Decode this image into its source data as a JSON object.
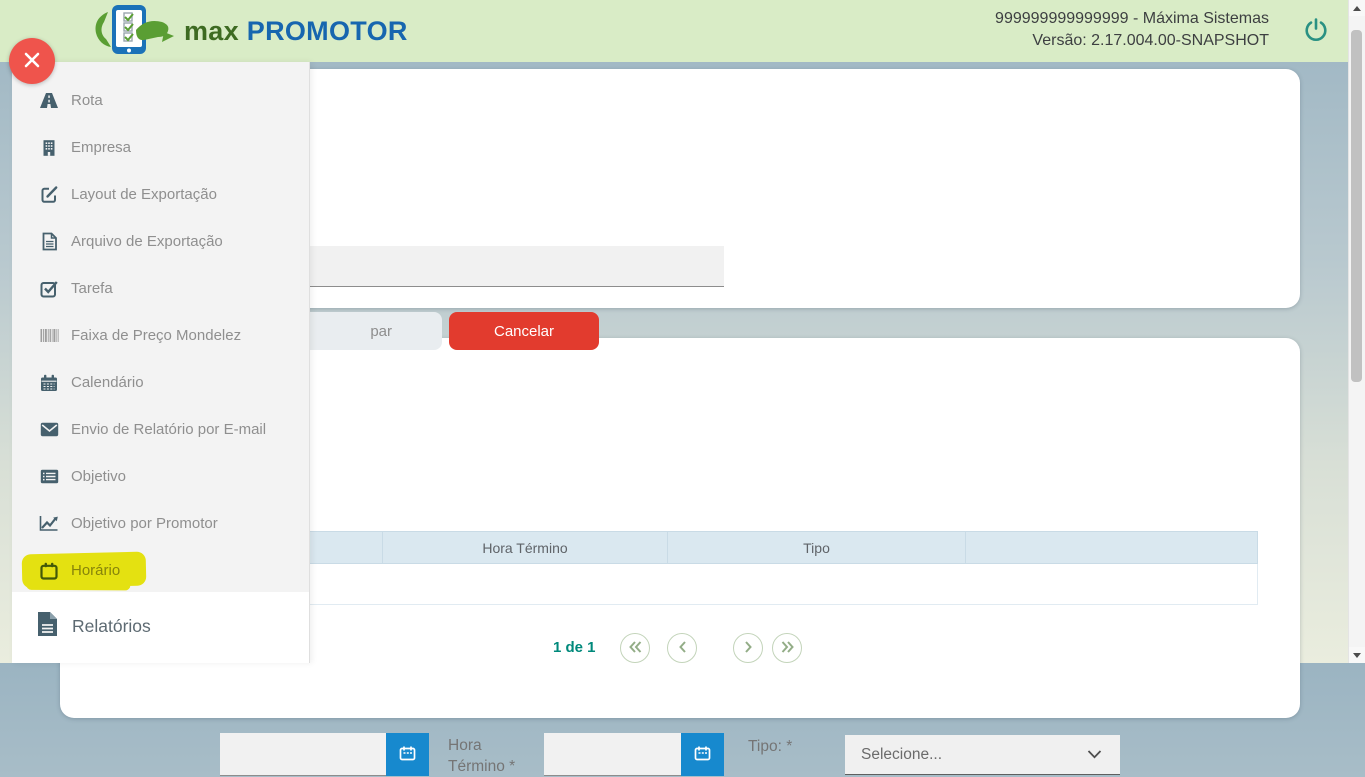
{
  "header": {
    "brand_max": "max",
    "brand_promotor": "PROMOTOR",
    "account": "999999999999999 - Máxima Sistemas",
    "version": "Versão: 2.17.004.00-SNAPSHOT",
    "power_icon": "power-icon"
  },
  "sidebar": {
    "close_icon": "close-icon",
    "items": [
      {
        "label": "Rota",
        "icon": "road-icon"
      },
      {
        "label": "Empresa",
        "icon": "building-icon"
      },
      {
        "label": "Layout de Exportação",
        "icon": "edit-icon"
      },
      {
        "label": "Arquivo de Exportação",
        "icon": "file-icon"
      },
      {
        "label": "Tarefa",
        "icon": "task-check-icon"
      },
      {
        "label": "Faixa de Preço Mondelez",
        "icon": "barcode-icon"
      },
      {
        "label": "Calendário",
        "icon": "calendar-icon"
      },
      {
        "label": "Envio de Relatório por E-mail",
        "icon": "envelope-icon"
      },
      {
        "label": "Objetivo",
        "icon": "list-icon"
      },
      {
        "label": "Objetivo por Promotor",
        "icon": "line-chart-icon"
      },
      {
        "label": "Horário",
        "icon": "schedule-icon",
        "highlighted": true
      }
    ],
    "report_item": {
      "label": "Relatórios",
      "icon": "report-icon"
    }
  },
  "form_card": {
    "search_input_value": "",
    "clear_button_visible": "par",
    "cancel_button": "Cancelar"
  },
  "schedule_card": {
    "hora_inicio_value": "",
    "hora_termino_label": "Hora Término *",
    "hora_termino_value": "",
    "tipo_label": "Tipo: *",
    "tipo_select_value": "Selecione...",
    "calendar_button_icon": "calendar-picker-icon",
    "table_headers": [
      "",
      "Hora Término",
      "Tipo",
      ""
    ],
    "table_rows": [
      [
        "",
        "",
        "",
        ""
      ]
    ],
    "pagination": {
      "page_label": "1 de 1",
      "buttons": [
        "first-page-icon",
        "prev-page-icon",
        "next-page-icon",
        "last-page-icon"
      ]
    }
  },
  "colors": {
    "header_bg": "#d9ecc6",
    "brand_green": "#3e6b22",
    "brand_blue": "#1766af",
    "accent_blue": "#1789ce",
    "cancel_red": "#e23b2e",
    "close_red": "#ef544c",
    "pagination_teal": "#00897b",
    "highlight_yellow": "#f0ec11",
    "table_header_bg": "#dae8f0"
  }
}
